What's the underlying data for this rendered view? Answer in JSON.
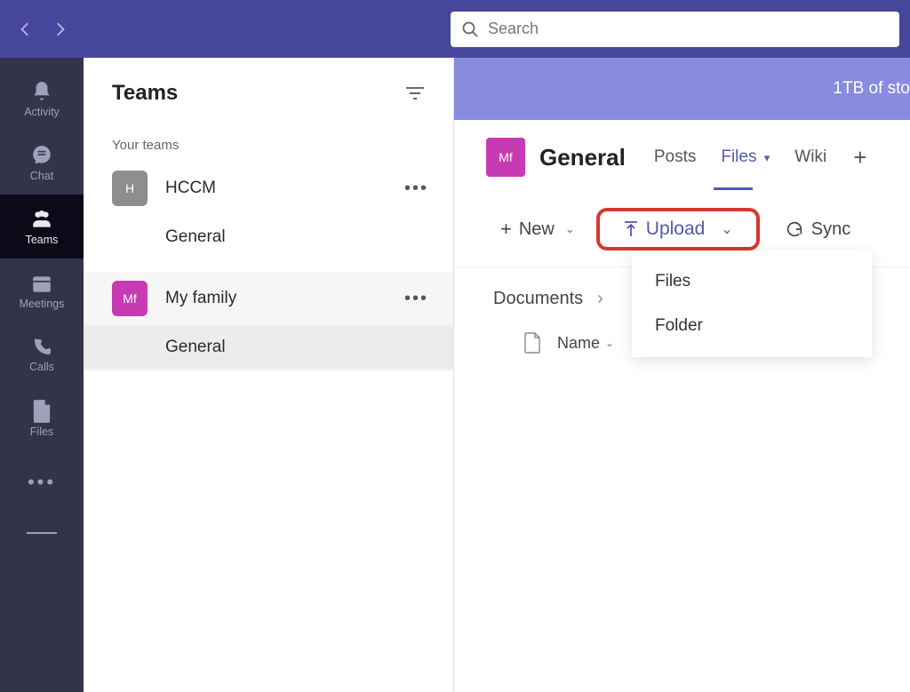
{
  "search": {
    "placeholder": "Search"
  },
  "rail": {
    "items": [
      {
        "label": "Activity"
      },
      {
        "label": "Chat"
      },
      {
        "label": "Teams"
      },
      {
        "label": "Meetings"
      },
      {
        "label": "Calls"
      },
      {
        "label": "Files"
      }
    ]
  },
  "panel": {
    "title": "Teams",
    "section_label": "Your teams",
    "teams": [
      {
        "badge": "H",
        "name": "HCCM",
        "channels": [
          "General"
        ]
      },
      {
        "badge": "Mf",
        "name": "My family",
        "channels": [
          "General"
        ]
      }
    ]
  },
  "banner": {
    "text": "1TB of sto"
  },
  "channel": {
    "badge": "Mf",
    "title": "General",
    "tabs": {
      "posts": "Posts",
      "files": "Files",
      "wiki": "Wiki"
    }
  },
  "toolbar": {
    "new_label": "New",
    "upload_label": "Upload",
    "sync_label": "Sync",
    "dropdown": {
      "files": "Files",
      "folder": "Folder"
    }
  },
  "breadcrumb": {
    "root": "Documents"
  },
  "columns": {
    "name": "Name"
  }
}
